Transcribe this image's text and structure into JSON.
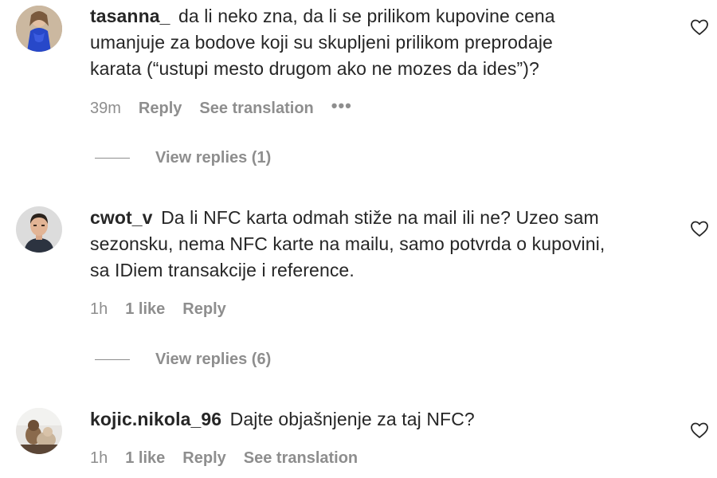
{
  "comments": [
    {
      "username": "tasanna_",
      "text_lines": [
        "da li neko zna, da li se prilikom kupovine cena",
        "umanjuje za bodove koji su skupljeni prilikom preprodaje",
        "karata (“ustupi mesto drugom ako ne mozes da ides”)?"
      ],
      "time": "39m",
      "likes": "",
      "reply_label": "Reply",
      "translate_label": "See translation",
      "more_label": "•••",
      "view_replies_label": "View replies (1)",
      "avatar_icon": "avatar-photo-blue-dress"
    },
    {
      "username": "cwot_v",
      "text_lines": [
        "Da li NFC karta odmah stiže na mail ili ne? Uzeo sam",
        "sezonsku, nema NFC karte na mailu, samo potvrda o kupovini,",
        "sa IDiem transakcije i reference."
      ],
      "time": "1h",
      "likes": "1 like",
      "reply_label": "Reply",
      "translate_label": "",
      "more_label": "",
      "view_replies_label": "View replies (6)",
      "avatar_icon": "avatar-photo-man"
    },
    {
      "username": "kojic.nikola_96",
      "text_lines": [
        "Dajte objašnjenje za taj NFC?"
      ],
      "time": "1h",
      "likes": "1 like",
      "reply_label": "Reply",
      "translate_label": "See translation",
      "more_label": "",
      "view_replies_label": "",
      "avatar_icon": "avatar-photo-dog"
    }
  ],
  "icons": {
    "like": "heart-outline-icon"
  },
  "colors": {
    "text": "#262626",
    "secondary": "#8e8e8e",
    "background": "#ffffff"
  }
}
